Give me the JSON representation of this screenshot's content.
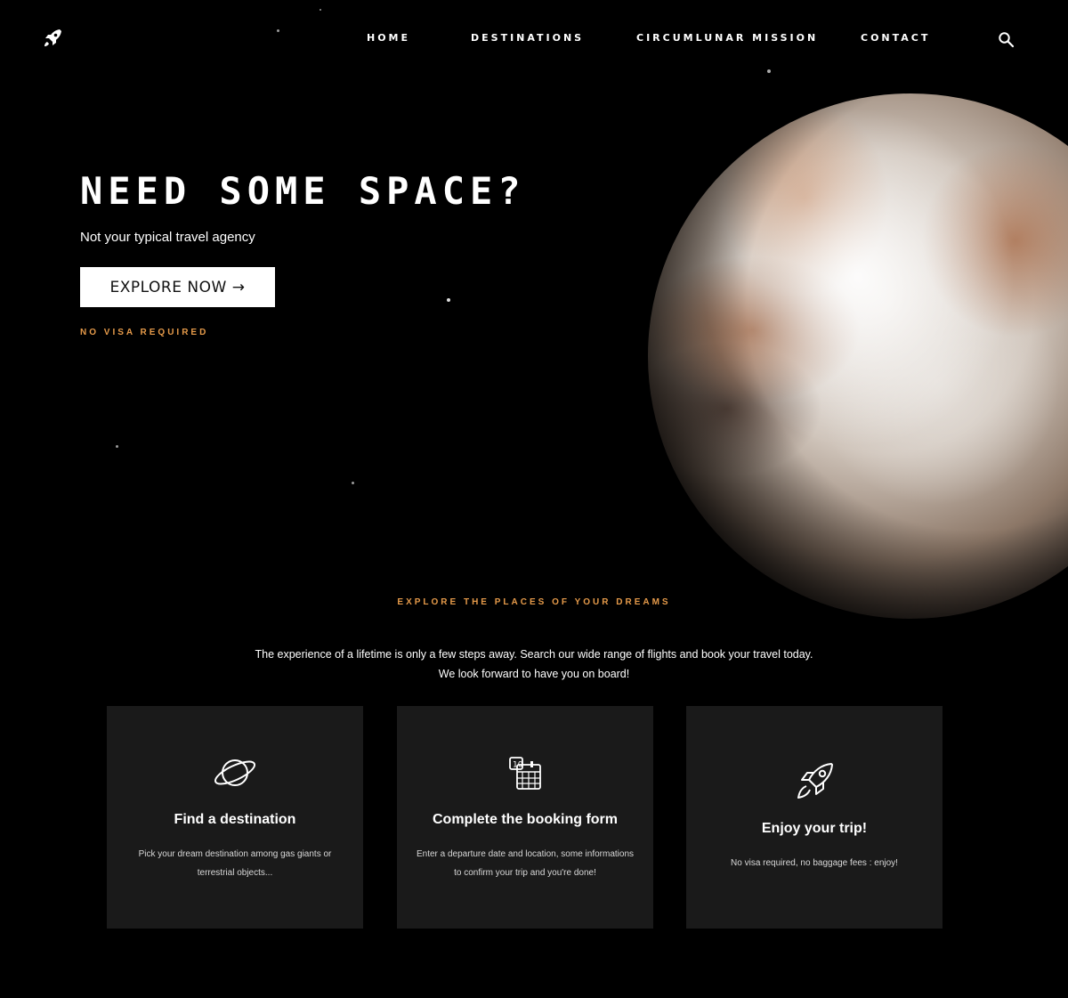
{
  "header": {
    "logo_icon": "rocket-icon",
    "nav": [
      {
        "label": "HOME"
      },
      {
        "label": "DESTINATIONS"
      },
      {
        "label": "CIRCUMLUNAR MISSION"
      },
      {
        "label": "CONTACT"
      }
    ],
    "search_icon": "search-icon"
  },
  "hero": {
    "title": "NEED SOME SPACE?",
    "subtitle": "Not your typical travel agency",
    "cta_label": "EXPLORE NOW →",
    "note": "NO VISA REQUIRED"
  },
  "section": {
    "eyebrow": "EXPLORE THE PLACES OF YOUR DREAMS",
    "text_line1": "The experience of a lifetime is only a few steps away. Search our wide range of flights and book your travel today.",
    "text_line2": "We look forward to have you on board!"
  },
  "cards": [
    {
      "icon": "planet-icon",
      "title": "Find a destination",
      "text": "Pick your dream destination among gas giants or terrestrial objects..."
    },
    {
      "icon": "calendar-icon",
      "title": "Complete the booking form",
      "text": "Enter a departure date and location, some informations to confirm your trip and you're done!"
    },
    {
      "icon": "rocket-icon",
      "title": "Enjoy your trip!",
      "text": "No visa required, no baggage fees : enjoy!"
    }
  ],
  "colors": {
    "background": "#000000",
    "accent": "#e59a4a",
    "card_background": "#1a1a1a",
    "button_background": "#ffffff"
  }
}
